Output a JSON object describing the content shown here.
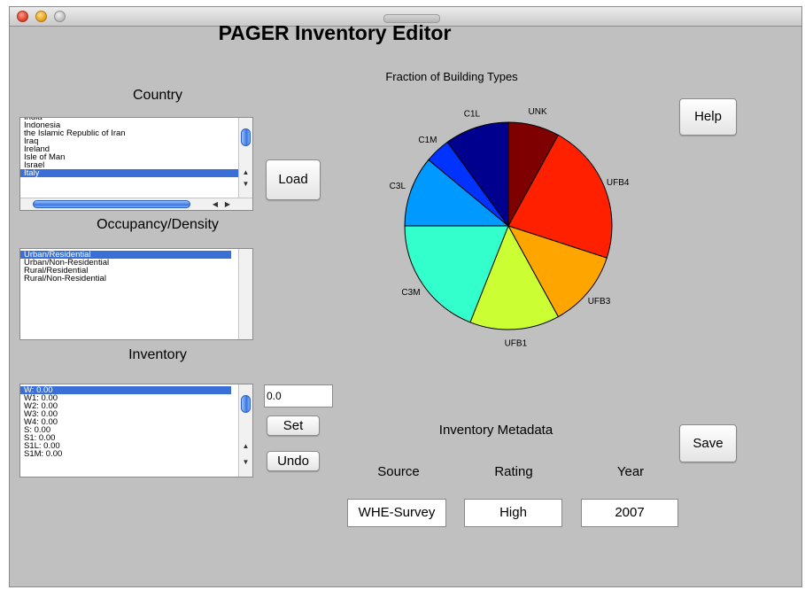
{
  "window": {
    "title": ""
  },
  "app_title": "PAGER Inventory Editor",
  "country": {
    "label": "Country",
    "items": [
      "India",
      "Indonesia",
      "the Islamic Republic of Iran",
      "Iraq",
      "Ireland",
      "Isle of Man",
      "Israel",
      "Italy"
    ],
    "selected": "Italy"
  },
  "occupancy": {
    "label": "Occupancy/Density",
    "items": [
      "Urban/Residential",
      "Urban/Non-Residential",
      "Rural/Residential",
      "Rural/Non-Residential"
    ],
    "selected": "Urban/Residential"
  },
  "inventory": {
    "label": "Inventory",
    "items": [
      "W: 0.00",
      "W1: 0.00",
      "W2: 0.00",
      "W3: 0.00",
      "W4: 0.00",
      "S: 0.00",
      "S1: 0.00",
      "S1L: 0.00",
      "S1M: 0.00"
    ],
    "selected": "W: 0.00",
    "value": "0.0"
  },
  "buttons": {
    "load": "Load",
    "set": "Set",
    "undo": "Undo",
    "help": "Help",
    "save": "Save"
  },
  "metadata": {
    "label": "Inventory Metadata",
    "source_label": "Source",
    "rating_label": "Rating",
    "year_label": "Year",
    "source": "WHE-Survey",
    "rating": "High",
    "year": "2007"
  },
  "chart_data": {
    "type": "pie",
    "title": "Fraction of Building Types",
    "slices": [
      {
        "label": "UNK",
        "value": 0.08,
        "color": "#7f0000"
      },
      {
        "label": "UFB4",
        "value": 0.22,
        "color": "#ff2000"
      },
      {
        "label": "UFB3",
        "value": 0.12,
        "color": "#ffa500"
      },
      {
        "label": "UFB1",
        "value": 0.14,
        "color": "#ccff33"
      },
      {
        "label": "C3M",
        "value": 0.19,
        "color": "#33ffcc"
      },
      {
        "label": "C3L",
        "value": 0.11,
        "color": "#0099ff"
      },
      {
        "label": "C1M",
        "value": 0.04,
        "color": "#0033ff"
      },
      {
        "label": "C1L",
        "value": 0.1,
        "color": "#00008f"
      }
    ]
  }
}
